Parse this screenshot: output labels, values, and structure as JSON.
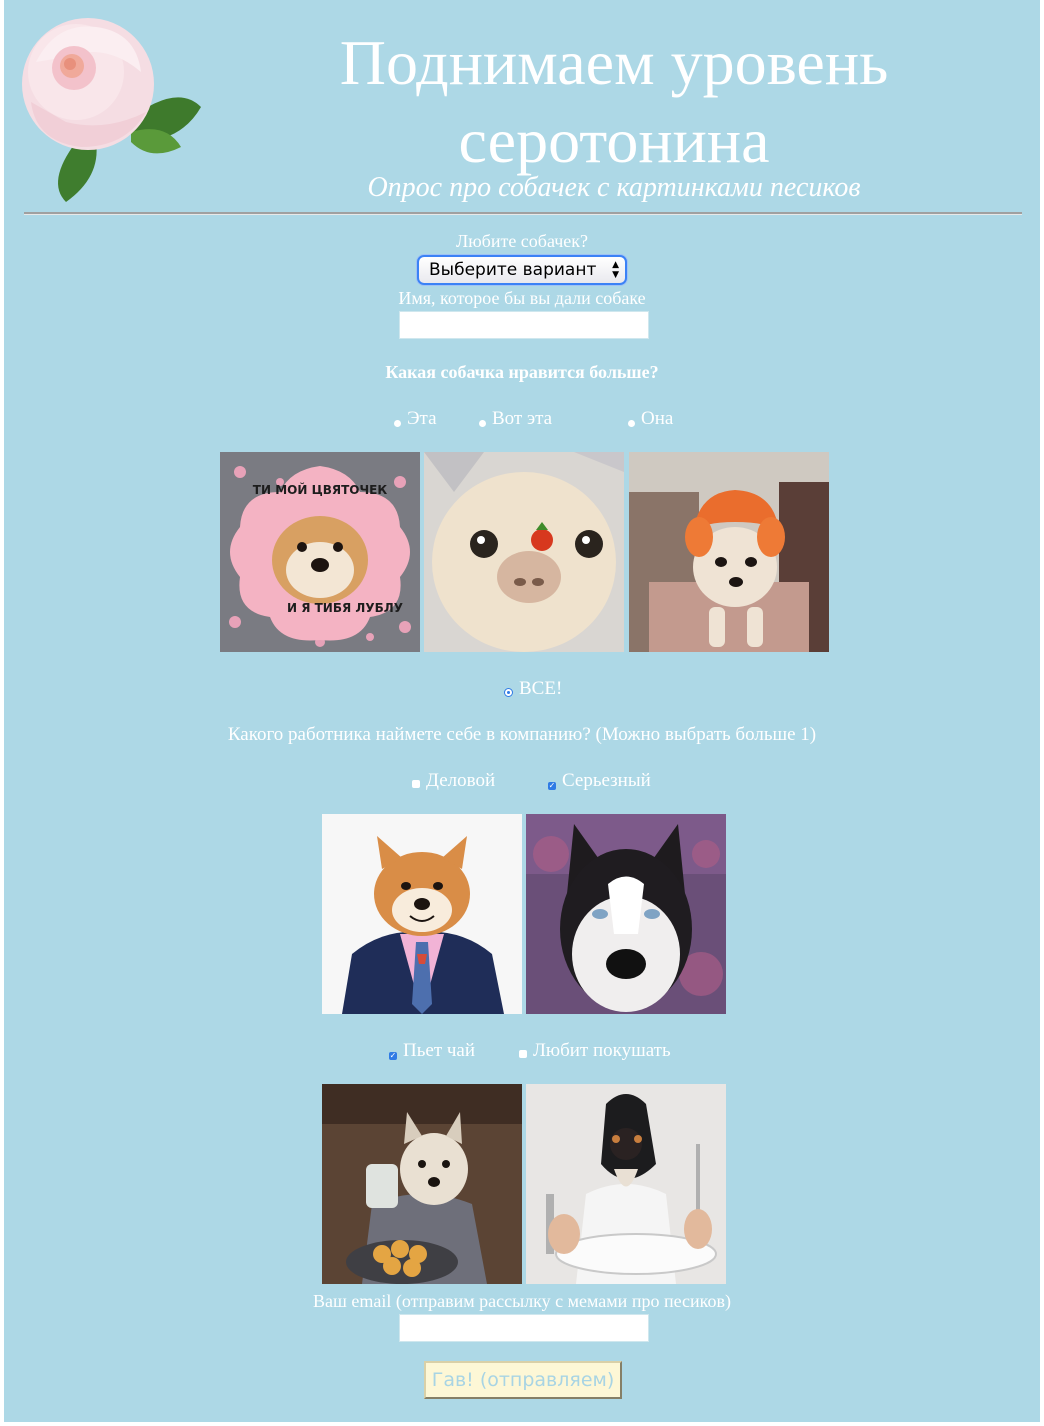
{
  "header": {
    "title": "Поднимаем уровень серотонина",
    "subtitle": "Опрос про собачек с картинками песиков"
  },
  "form": {
    "love_dogs": {
      "label": "Любите собачек?",
      "selected": "Выберите вариант"
    },
    "dog_name": {
      "label": "Имя, которое бы вы дали собаке",
      "value": ""
    },
    "favorite_dog": {
      "question": "Какая собачка нравится больше?",
      "options": [
        "Эта",
        "Вот эта",
        "Она"
      ],
      "all_option": "ВСЕ!",
      "selected": "ВСЕ!",
      "images": [
        "shiba-flower",
        "chihuahua-tomato",
        "chihuahua-tangerine"
      ],
      "meme_top": "ТИ МОЙ ЦВЯТОЧЕК",
      "meme_bottom": "И Я ТИБЯ ЛУБЛУ"
    },
    "worker": {
      "question": "Какого работника наймете себе в компанию? (Можно выбрать больше 1)",
      "options": [
        {
          "label": "Деловой",
          "checked": false
        },
        {
          "label": "Серьезный",
          "checked": true
        },
        {
          "label": "Пьет чай",
          "checked": true
        },
        {
          "label": "Любит покушать",
          "checked": false
        }
      ]
    },
    "email": {
      "label": "Ваш email (отправим рассылку с мемами про песиков)",
      "value": ""
    },
    "submit_label": "Гав! (отправляем)"
  },
  "colors": {
    "background": "#add8e6",
    "text": "#ffffff",
    "accent": "#2f7be5",
    "button_bg": "#fdf7d6"
  }
}
